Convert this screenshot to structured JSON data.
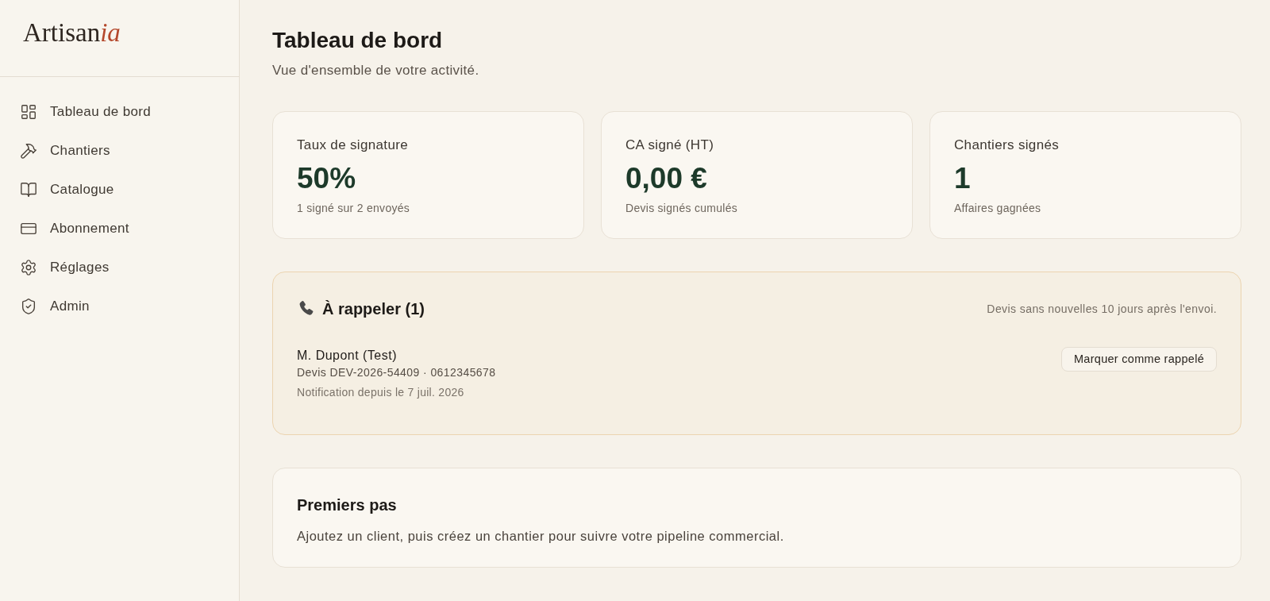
{
  "sidebar": {
    "logo": {
      "name": "Artisan",
      "accent": "ia"
    },
    "items": [
      {
        "label": "Tableau de bord",
        "kind": "dashboard"
      },
      {
        "label": "Chantiers",
        "kind": "hammer"
      },
      {
        "label": "Catalogue",
        "kind": "book"
      },
      {
        "label": "Abonnement",
        "kind": "card"
      },
      {
        "label": "Réglages",
        "kind": "settings"
      },
      {
        "label": "Admin",
        "kind": "shield"
      }
    ]
  },
  "page": {
    "title": "Tableau de bord",
    "subtitle": "Vue d'ensemble de votre activité."
  },
  "stats": [
    {
      "label": "Taux de signature",
      "value": "50%",
      "caption": "1 signé sur 2 envoyés"
    },
    {
      "label": "CA signé (HT)",
      "value": "0,00 €",
      "caption": "Devis signés cumulés"
    },
    {
      "label": "Chantiers signés",
      "value": "1",
      "caption": "Affaires gagnées"
    }
  ],
  "callbacks": {
    "title": "À rappeler (1)",
    "note": "Devis sans nouvelles 10 jours après l'envoi.",
    "items": [
      {
        "name": "M. Dupont (Test)",
        "details": "Devis DEV-2026-54409 · 0612345678",
        "since": "Notification depuis le 7 juil. 2026",
        "action": "Marquer comme rappelé"
      }
    ]
  },
  "first_steps": {
    "title": "Premiers pas",
    "text": "Ajoutez un client, puis créez un chantier pour suivre votre pipeline commercial."
  }
}
